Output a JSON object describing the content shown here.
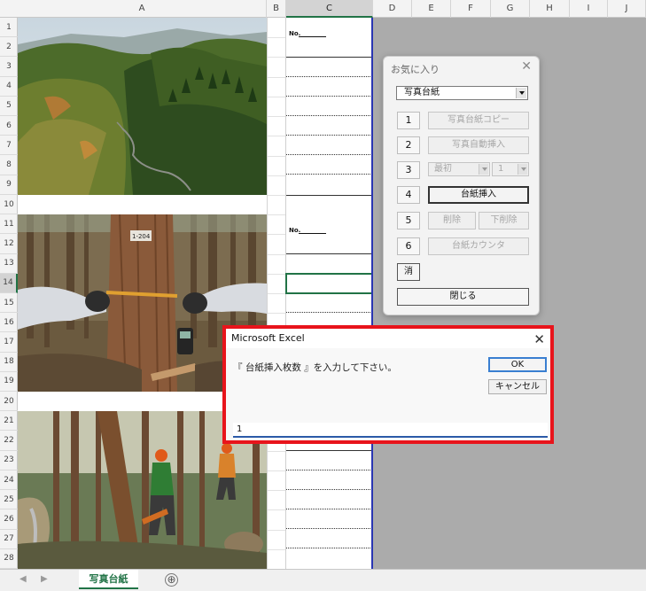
{
  "columns": [
    "A",
    "B",
    "C",
    "D",
    "E",
    "F",
    "G",
    "H",
    "I",
    "J"
  ],
  "rows": [
    "1",
    "2",
    "3",
    "4",
    "5",
    "6",
    "7",
    "8",
    "9",
    "10",
    "11",
    "12",
    "13",
    "14",
    "15",
    "16",
    "17",
    "18",
    "19",
    "20",
    "21",
    "22",
    "23",
    "24",
    "25",
    "26",
    "27",
    "28"
  ],
  "selected_column": "C",
  "selected_row": "14",
  "photo_labels": {
    "no_label": "No.",
    "tree_tag": "1-204"
  },
  "sheet_tab": {
    "label": "写真台紙",
    "add_label": "⊕"
  },
  "favorites": {
    "title": "お気に入り",
    "close": "✕",
    "template_select": "写真台紙",
    "numbers": [
      "1",
      "2",
      "3",
      "4",
      "5",
      "6"
    ],
    "copy_button": "写真台紙コピー",
    "auto_insert_button": "写真自動挿入",
    "first_select": "最初",
    "count_select": "1",
    "insert_button": "台紙挿入",
    "delete_button": "削除",
    "delete_below_button": "下削除",
    "counter_button": "台紙カウンタ",
    "erase_button": "消",
    "close_button": "閉じる"
  },
  "dialog": {
    "title": "Microsoft Excel",
    "close": "✕",
    "prompt": "『 台紙挿入枚数 』を入力して下さい。",
    "ok_label": "OK",
    "cancel_label": "キャンセル",
    "input_value": "1"
  },
  "colors": {
    "excel_green": "#217346",
    "highlight_red": "#e8141b",
    "page_break_blue": "#2a36b3"
  }
}
